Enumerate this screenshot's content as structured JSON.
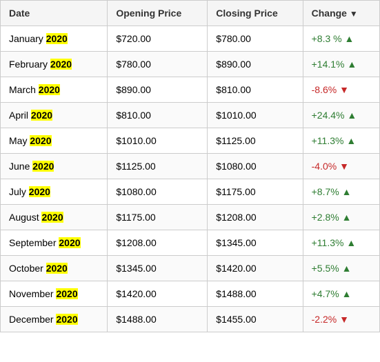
{
  "table": {
    "headers": [
      "Date",
      "Opening Price",
      "Closing Price",
      "Change"
    ],
    "rows": [
      {
        "month": "January",
        "year": "2020",
        "opening": "$720.00",
        "closing": "$780.00",
        "change": "+8.3 %",
        "direction": "positive"
      },
      {
        "month": "February",
        "year": "2020",
        "opening": "$780.00",
        "closing": "$890.00",
        "change": "+14.1%",
        "direction": "positive"
      },
      {
        "month": "March",
        "year": "2020",
        "opening": "$890.00",
        "closing": "$810.00",
        "change": "-8.6%",
        "direction": "negative"
      },
      {
        "month": "April",
        "year": "2020",
        "opening": "$810.00",
        "closing": "$1010.00",
        "change": "+24.4%",
        "direction": "positive"
      },
      {
        "month": "May",
        "year": "2020",
        "opening": "$1010.00",
        "closing": "$1125.00",
        "change": "+11.3%",
        "direction": "positive"
      },
      {
        "month": "June",
        "year": "2020",
        "opening": "$1125.00",
        "closing": "$1080.00",
        "change": "-4.0%",
        "direction": "negative"
      },
      {
        "month": "July",
        "year": "2020",
        "opening": "$1080.00",
        "closing": "$1175.00",
        "change": "+8.7%",
        "direction": "positive"
      },
      {
        "month": "August",
        "year": "2020",
        "opening": "$1175.00",
        "closing": "$1208.00",
        "change": "+2.8%",
        "direction": "positive"
      },
      {
        "month": "September",
        "year": "2020",
        "opening": "$1208.00",
        "closing": "$1345.00",
        "change": "+11.3%",
        "direction": "positive"
      },
      {
        "month": "October",
        "year": "2020",
        "opening": "$1345.00",
        "closing": "$1420.00",
        "change": "+5.5%",
        "direction": "positive"
      },
      {
        "month": "November",
        "year": "2020",
        "opening": "$1420.00",
        "closing": "$1488.00",
        "change": "+4.7%",
        "direction": "positive"
      },
      {
        "month": "December",
        "year": "2020",
        "opening": "$1488.00",
        "closing": "$1455.00",
        "change": "-2.2%",
        "direction": "negative"
      }
    ]
  }
}
